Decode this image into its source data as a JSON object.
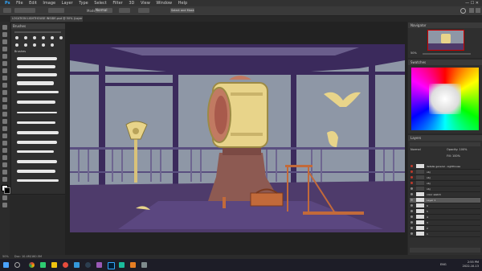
{
  "menubar": {
    "items": [
      "File",
      "Edit",
      "Image",
      "Layer",
      "Type",
      "Select",
      "Filter",
      "3D",
      "View",
      "Window",
      "Help"
    ]
  },
  "options": {
    "mode_label": "Mode:",
    "mode_value": "Normal",
    "select_mask_label": "Select and Mask..."
  },
  "document": {
    "tab_title": "LOCATION LIGHTHOUSE INSIDE.psd @ 50% (Layer 1, RGB/8)"
  },
  "brushes": {
    "title": "Brushes",
    "size_labels": [
      "30",
      "30",
      "30",
      "30",
      "30",
      "25",
      "25",
      "36",
      "25",
      "25",
      "36"
    ],
    "group_label": "Brushes"
  },
  "navigator": {
    "title": "Navigator",
    "zoom": "50%"
  },
  "swatches": {
    "title": "Swatches",
    "colors": [
      "#ff0000",
      "#ff8000",
      "#ffff00",
      "#80ff00",
      "#00ff00",
      "#00ff80",
      "#00ffff",
      "#0080ff",
      "#0000ff",
      "#8000ff",
      "#ff00ff",
      "#ff0080"
    ]
  },
  "layers": {
    "title": "Layers",
    "blend": "Normal",
    "opacity_label": "Opacity: 100%",
    "fill_label": "Fill: 100%",
    "rows": [
      {
        "name": "detalle general - Lighthouse",
        "active": false
      },
      {
        "name": "obj",
        "active": false
      },
      {
        "name": "obj",
        "active": false
      },
      {
        "name": "obj",
        "active": false
      },
      {
        "name": "obj",
        "active": false
      },
      {
        "name": "color sketch",
        "active": false
      },
      {
        "name": "Layer 1",
        "active": true
      },
      {
        "name": "6",
        "active": false
      },
      {
        "name": "5",
        "active": false
      },
      {
        "name": "4",
        "active": false
      },
      {
        "name": "3",
        "active": false
      },
      {
        "name": "2",
        "active": false
      },
      {
        "name": "1",
        "active": false
      }
    ]
  },
  "status": {
    "zoom": "50%",
    "doc_size": "Doc: 10.4M/160.5M"
  },
  "taskbar": {
    "time": "2:55 PM",
    "date": "2022-10-13",
    "lang": "ENG"
  },
  "colors": {
    "wall": "#8e97a6",
    "floor": "#4e3b6b",
    "frame": "#3b2a5c",
    "yellow": "#e8d48a",
    "base": "#8d5a52"
  }
}
